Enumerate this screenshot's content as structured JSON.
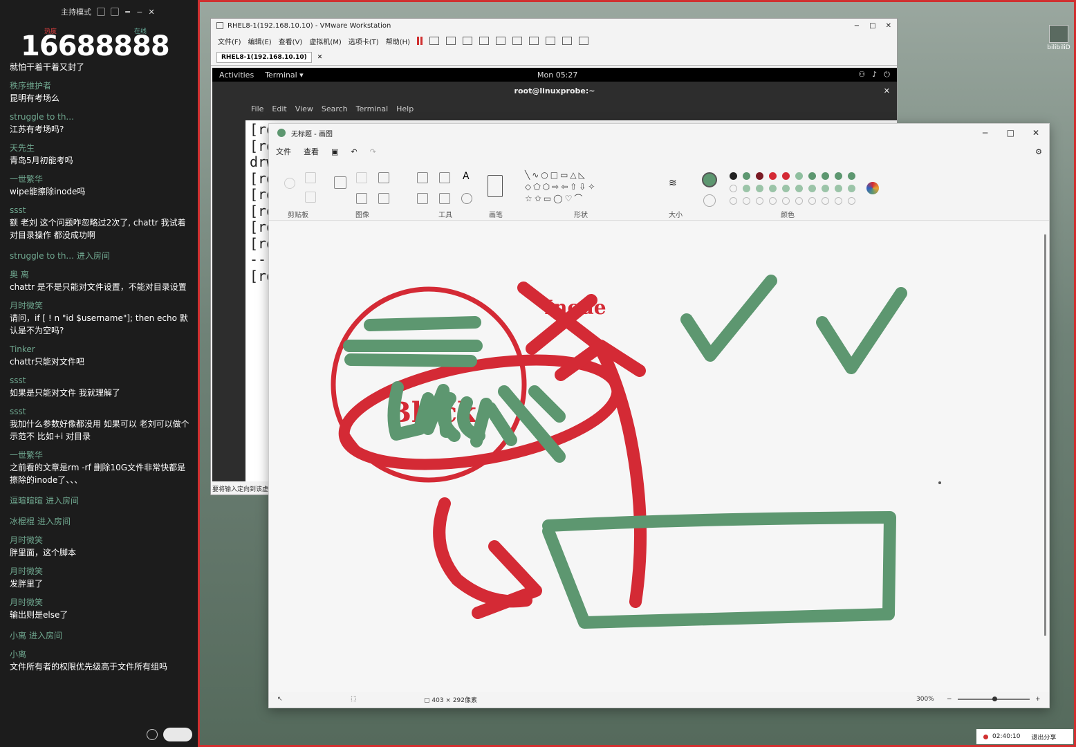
{
  "chat": {
    "header_title": "主持模式",
    "counter": "16688888",
    "brand": "bili",
    "messages": [
      {
        "user": "",
        "text": "就怕干着干着又封了"
      },
      {
        "user": "秩序维护者",
        "text": "昆明有考场么"
      },
      {
        "user": "struggle to th...",
        "text": "江苏有考场吗?"
      },
      {
        "user": "天先生",
        "text": "青岛5月初能考吗"
      },
      {
        "user": "一世繁华",
        "text": "wipe能擦除inode吗"
      },
      {
        "user": "ssst",
        "text": "额 老刘 这个问题咋忽略过2次了, chattr 我试着对目录操作 都没成功啊"
      },
      {
        "user": "struggle to th...",
        "text": "进入房间",
        "enter": true
      },
      {
        "user": "奥 离",
        "text": "chattr 是不是只能对文件设置，不能对目录设置"
      },
      {
        "user": "月时微笑",
        "text": "请问，if [ ! n \"id $username\"]; then echo 默认是不为空吗?"
      },
      {
        "user": "Tinker",
        "text": "chattr只能对文件吧"
      },
      {
        "user": "ssst",
        "text": "如果是只能对文件 我就理解了"
      },
      {
        "user": "ssst",
        "text": "我加什么参数好像都没用 如果可以 老刘可以做个示范不 比如+i 对目录"
      },
      {
        "user": "一世繁华",
        "text": "之前看的文章是rm -rf 删除10G文件非常快都是擦除的inode了、、、"
      },
      {
        "user": "逗暄暄暄",
        "text": "进入房间",
        "enter": true
      },
      {
        "user": "冰棍棍",
        "text": "进入房间",
        "enter": true
      },
      {
        "user": "月时微笑",
        "text": "胖里面，这个脚本"
      },
      {
        "user": "月时微笑",
        "text": "发胖里了"
      },
      {
        "user": "月时微笑",
        "text": "输出则是else了"
      },
      {
        "user": "小离",
        "text": "进入房间",
        "enter": true
      },
      {
        "user": "小离",
        "text": "文件所有者的权限优先级高于文件所有组吗"
      }
    ]
  },
  "vmware": {
    "title": "RHEL8-1(192.168.10.10) - VMware Workstation",
    "menu": [
      "文件(F)",
      "编辑(E)",
      "查看(V)",
      "虚拟机(M)",
      "选项卡(T)",
      "帮助(H)"
    ],
    "tab": "RHEL8-1(192.168.10.10)",
    "status": "要将输入定向到该虚"
  },
  "gnome": {
    "activities": "Activities",
    "app": "Terminal ▾",
    "clock": "Mon 05:27"
  },
  "terminal": {
    "title": "root@linuxprobe:~",
    "menu": [
      "File",
      "Edit",
      "View",
      "Search",
      "Terminal",
      "Help"
    ],
    "lines": [
      "[ro",
      "[ro",
      "drw",
      "[ro",
      "[ro",
      "[ro",
      "[ro",
      "[ro",
      "---",
      "[ro"
    ]
  },
  "paint": {
    "title": "无标题 - 画图",
    "menu": [
      "文件",
      "查看"
    ],
    "groups": [
      "剪贴板",
      "图像",
      "工具",
      "画笔",
      "形状",
      "大小",
      "颜色"
    ],
    "canvas_text": [
      "Inode",
      "Block"
    ],
    "dimensions": "403 × 292像素",
    "zoom": "300%",
    "colors": {
      "red": "#d42a35",
      "green": "#5d9770",
      "row1": [
        "#222222",
        "#5d9770",
        "#7a1a24",
        "#d42a35",
        "#d42a35",
        "#8fbf9f",
        "#5d9770",
        "#5d9770",
        "#5d9770",
        "#5d9770"
      ]
    }
  },
  "shortcut": "bilibiliD",
  "recording": {
    "time": "02:40:10",
    "label": "退出分享"
  }
}
